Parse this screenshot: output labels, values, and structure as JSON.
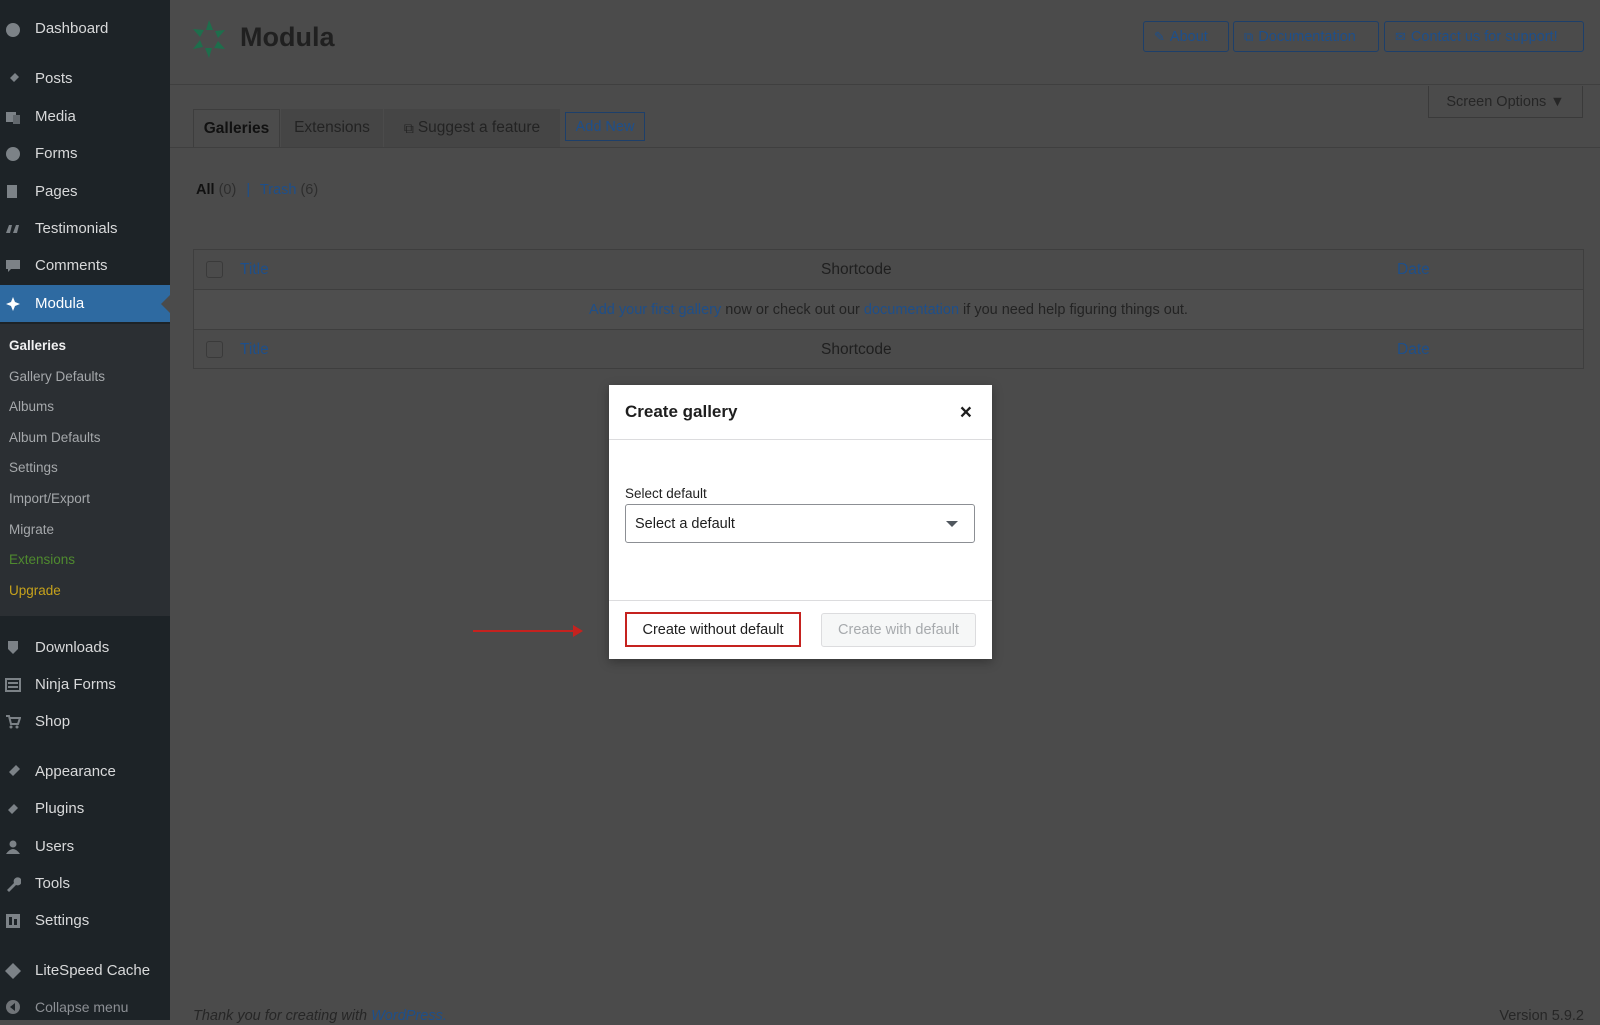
{
  "sidebar": {
    "items": [
      {
        "label": "Dashboard",
        "icon": "dashboard-icon"
      },
      {
        "label": "Posts",
        "icon": "pin-icon"
      },
      {
        "label": "Media",
        "icon": "media-icon"
      },
      {
        "label": "Forms",
        "icon": "forms-icon"
      },
      {
        "label": "Pages",
        "icon": "pages-icon"
      },
      {
        "label": "Testimonials",
        "icon": "quote-icon"
      },
      {
        "label": "Comments",
        "icon": "comment-icon"
      },
      {
        "label": "Modula",
        "icon": "modula-icon"
      },
      {
        "label": "Downloads",
        "icon": "download-icon"
      },
      {
        "label": "Ninja Forms",
        "icon": "ninja-forms-icon"
      },
      {
        "label": "Shop",
        "icon": "cart-icon"
      },
      {
        "label": "Appearance",
        "icon": "brush-icon"
      },
      {
        "label": "Plugins",
        "icon": "plugin-icon"
      },
      {
        "label": "Users",
        "icon": "user-icon"
      },
      {
        "label": "Tools",
        "icon": "wrench-icon"
      },
      {
        "label": "Settings",
        "icon": "settings-icon"
      },
      {
        "label": "LiteSpeed Cache",
        "icon": "litespeed-icon"
      },
      {
        "label": "Collapse menu",
        "icon": "collapse-icon"
      }
    ],
    "submenu": [
      "Galleries",
      "Gallery Defaults",
      "Albums",
      "Album Defaults",
      "Settings",
      "Import/Export",
      "Migrate",
      "Extensions",
      "Upgrade"
    ]
  },
  "header": {
    "brand": "Modula",
    "buttons": [
      "About",
      "Documentation",
      "Contact us for support!"
    ],
    "screen_options": "Screen Options ▼"
  },
  "tabs": [
    "Galleries",
    "Extensions",
    "Suggest a feature"
  ],
  "add_new": "Add New",
  "views": {
    "all": "All",
    "all_count": "(0)",
    "sep": "|",
    "trash": "Trash",
    "trash_count": "(6)"
  },
  "table": {
    "col_title": "Title",
    "col_shortcode": "Shortcode",
    "col_date": "Date",
    "empty_link1": "Add your first gallery",
    "empty_text1": "now or check out our",
    "empty_link2": "documentation",
    "empty_text2": "if you need help figuring things out."
  },
  "footer": {
    "thanks": "Thank you for creating with",
    "wp": "WordPress.",
    "version": "Version 5.9.2"
  },
  "modal": {
    "title": "Create gallery",
    "close": "×",
    "label": "Select default",
    "select_value": "Select a default",
    "btn_without": "Create without default",
    "btn_with": "Create with default"
  },
  "colors": {
    "accent": "#2e6aa1",
    "link": "#1e4f8a",
    "highlight": "#c5221f"
  }
}
